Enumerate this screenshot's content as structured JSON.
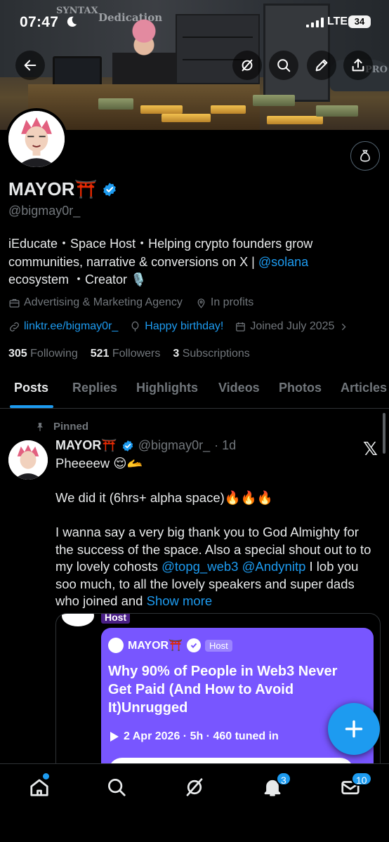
{
  "status_bar": {
    "time": "07:47",
    "network": "LTE",
    "battery": "34"
  },
  "profile": {
    "name": "MAYOR⛩️",
    "handle": "@bigmay0r_",
    "bio_line1": "iEducate・Space Host・Helping crypto founders grow",
    "bio_line2": "communities, narrative & conversions on X | ",
    "bio_mention": "@solana",
    "bio_line3": "ecosystem ・Creator 🎙️",
    "category": "Advertising & Marketing Agency",
    "location": "In profits",
    "website": "linktr.ee/bigmay0r_",
    "birthday": "Happy birthday!",
    "joined": "Joined July 2025",
    "following_count": "305",
    "following_label": "Following",
    "followers_count": "521",
    "followers_label": "Followers",
    "subscriptions_count": "3",
    "subscriptions_label": "Subscriptions"
  },
  "tabs": [
    "Posts",
    "Replies",
    "Highlights",
    "Videos",
    "Photos",
    "Articles"
  ],
  "post": {
    "pinned_label": "Pinned",
    "author": "MAYOR⛩️",
    "handle": "@bigmay0r_",
    "time": "· 1d",
    "line1": "Pheeeew 😌🫴",
    "line2": "We did it (6hrs+ alpha space)🔥🔥🔥",
    "line3a": "I wanna say a very big thank you to God Almighty for the success of the space. Also a special shout out to to my lovely cohosts ",
    "mention1": "@topg_web3",
    "mention2": "@Andynitp",
    "line3b": " I lob you soo much, to all the lovely speakers and super dads who joined and ",
    "show_more": "Show more"
  },
  "embed": {
    "host_tag": "Host",
    "space_host_name": "MAYOR⛩️",
    "space_host_badge": "Host",
    "space_title": "Why 90% of People in Web3 Never Get Paid (And How to Avoid It)Unrugged",
    "space_meta": "2 Apr 2026 · 5h · 460 tuned in"
  },
  "nav": {
    "notifications_badge": "3",
    "messages_badge": "10"
  },
  "banner": {
    "sign1": "SYNTAX",
    "sign2": "Dedication",
    "sign3": "PRO"
  },
  "colors": {
    "accent": "#1d9bf0",
    "background": "#000000",
    "muted": "#71767b",
    "space_purple": "#7856ff"
  }
}
